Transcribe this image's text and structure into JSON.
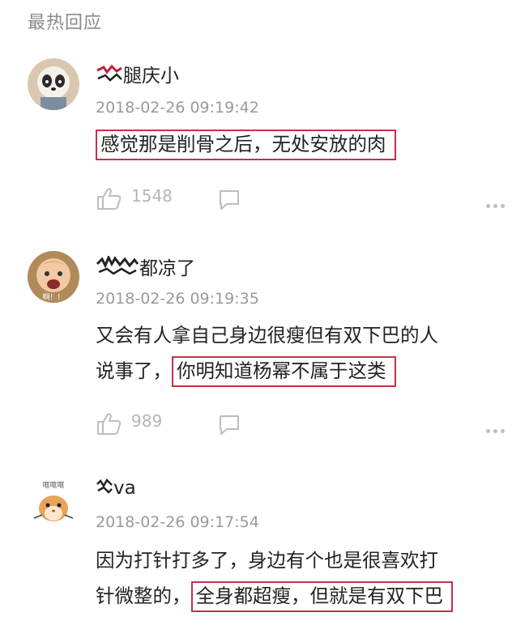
{
  "section_title": "最热回应",
  "comments": [
    {
      "username_suffix": "腿庆小",
      "timestamp": "2018-02-26 09:19:42",
      "text_lines": [],
      "highlight": "感觉那是削骨之后，无处安放的肉",
      "likes": "1548",
      "avatar_label": ""
    },
    {
      "username_suffix": "都凉了",
      "timestamp": "2018-02-26 09:19:35",
      "text_lines": [
        "又会有人拿自己身边很瘦但有双下巴的人"
      ],
      "text_prefix": "说事了，",
      "highlight": "你明知道杨幂不属于这类",
      "likes": "989",
      "avatar_label": "啊！！"
    },
    {
      "username_suffix": "va",
      "timestamp": "2018-02-26 09:17:54",
      "text_lines": [
        "因为打针打多了，身边有个也是很喜欢打"
      ],
      "text_prefix": "针微整的，",
      "highlight": "全身都超瘦，但就是有双下巴",
      "avatar_label": "哐哐哐"
    }
  ],
  "colors": {
    "highlight_border": "#c4314b",
    "meta": "#9a9a9a"
  }
}
